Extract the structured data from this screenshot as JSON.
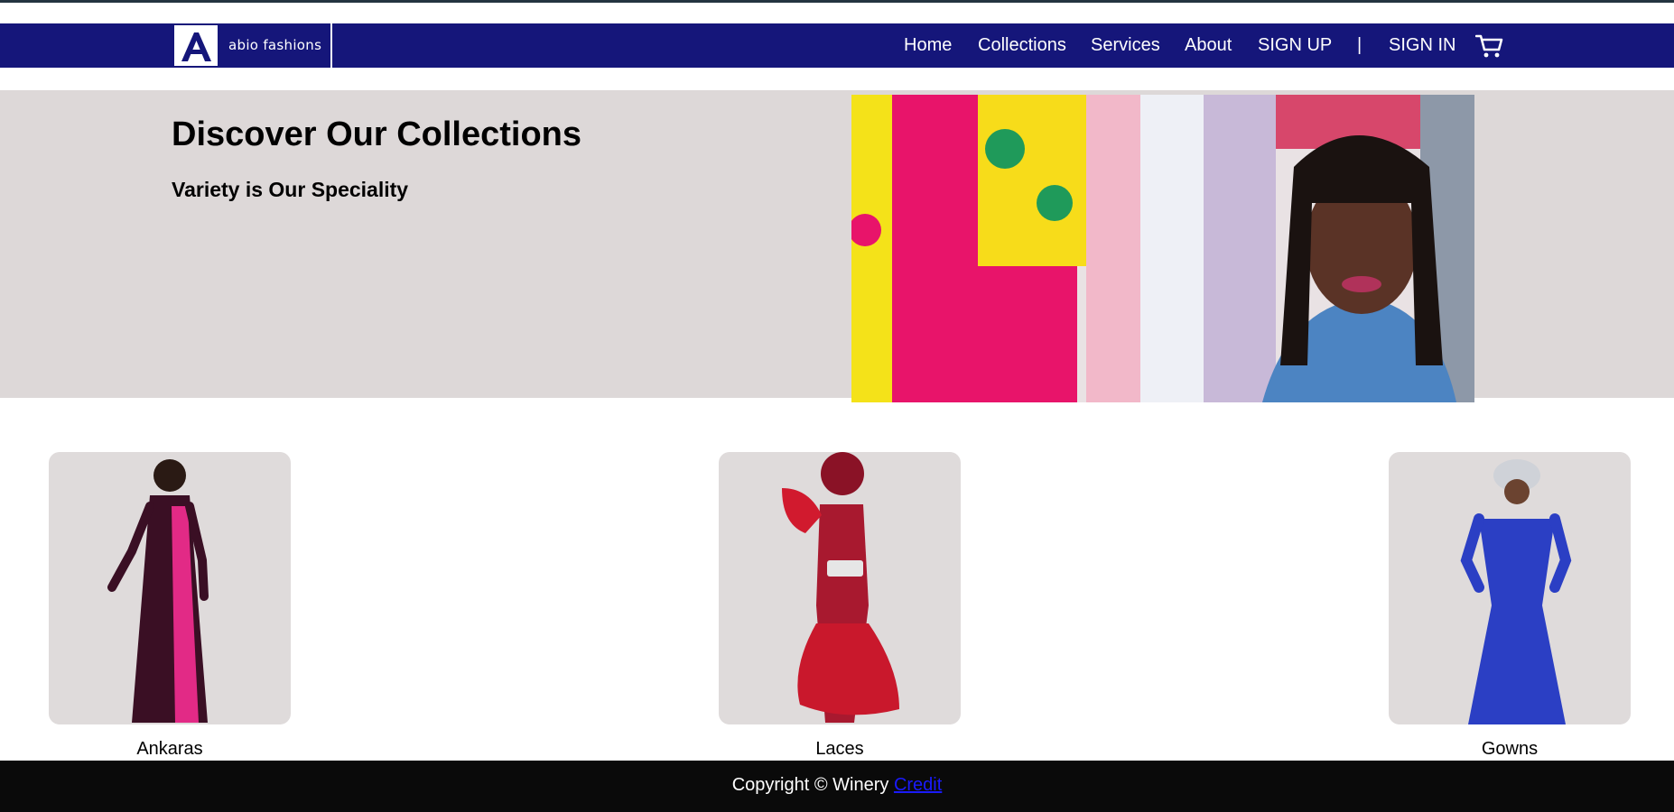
{
  "header": {
    "logo_letter": "A",
    "logo_text": "abio fashions",
    "nav": {
      "home": "Home",
      "collections": "Collections",
      "services": "Services",
      "about": "About",
      "signup": "SIGN UP",
      "separator": "|",
      "signin": "SIGN IN"
    },
    "cart_icon": "shopping-cart-icon"
  },
  "hero": {
    "title": "Discover Our Collections",
    "subtitle": "Variety is Our Speciality"
  },
  "collections": [
    {
      "label": "Ankaras"
    },
    {
      "label": "Laces"
    },
    {
      "label": "Gowns"
    }
  ],
  "footer": {
    "copyright": "Copyright © Winery",
    "credit_link": "Credit"
  },
  "colors": {
    "navbar": "#15167a",
    "hero_bg": "#ddd8d8",
    "card_bg": "#dfdbdb",
    "footer_bg": "#0a0a0a",
    "link": "#1a1aff"
  }
}
